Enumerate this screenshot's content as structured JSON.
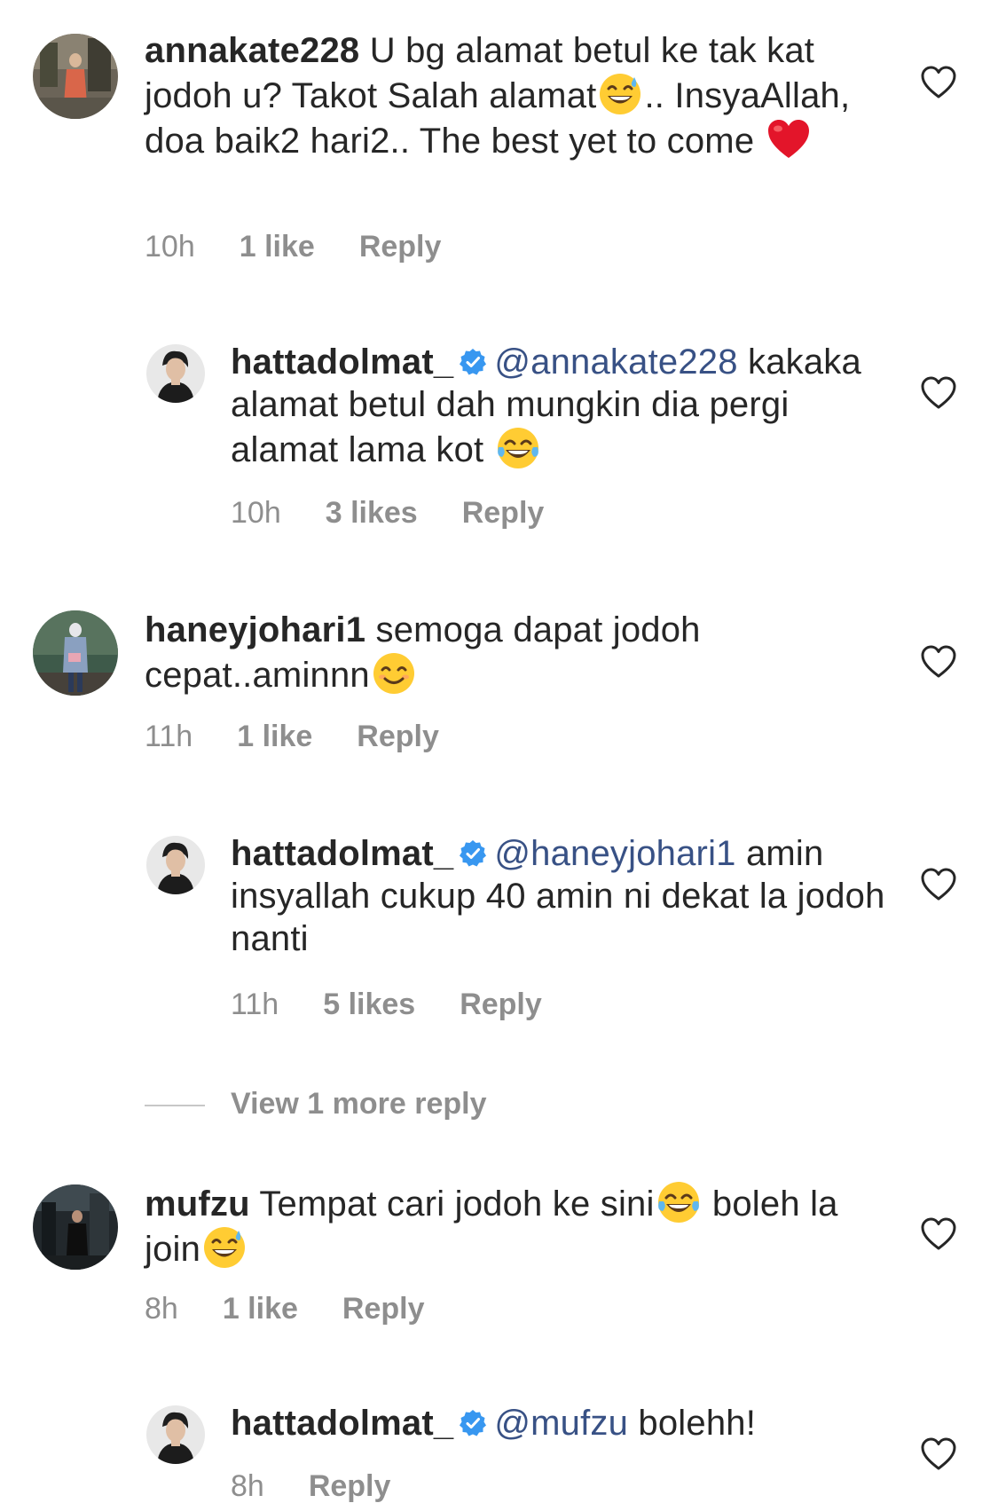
{
  "comments": [
    {
      "username": "annakate228",
      "text_1": "U bg alamat betul ke tak kat jodoh u? Takot Salah alamat",
      "emoji_1": "sweat-smile-emoji",
      "text_2": ".. InsyaAllah, doa baik2 hari2.. The best yet to come",
      "emoji_2": "red-heart-emoji",
      "time": "10h",
      "likes": "1 like",
      "reply": "Reply"
    },
    {
      "username": "hattadolmat_",
      "verified": true,
      "mention": "@annakate228",
      "text_1": "kakaka alamat betul dah mungkin dia pergi alamat lama kot",
      "emoji_1": "tears-of-joy-emoji",
      "time": "10h",
      "likes": "3 likes",
      "reply": "Reply"
    },
    {
      "username": "haneyjohari1",
      "text_1": "semoga dapat jodoh cepat..aminnn",
      "emoji_1": "smiling-emoji",
      "time": "11h",
      "likes": "1 like",
      "reply": "Reply"
    },
    {
      "username": "hattadolmat_",
      "verified": true,
      "mention": "@haneyjohari1",
      "text_1": "amin insyallah cukup 40 amin ni dekat la jodoh nanti",
      "time": "11h",
      "likes": "5 likes",
      "reply": "Reply"
    },
    {
      "username": "mufzu",
      "text_1": "Tempat cari jodoh ke sini",
      "emoji_1": "tears-of-joy-emoji",
      "text_2": " boleh la join",
      "emoji_2": "sweat-smile-emoji",
      "time": "8h",
      "likes": "1 like",
      "reply": "Reply"
    },
    {
      "username": "hattadolmat_",
      "verified": true,
      "mention": "@mufzu",
      "text_1": "bolehh!",
      "time": "8h",
      "reply": "Reply"
    }
  ],
  "view_more": "View 1 more reply",
  "colors": {
    "text": "#262626",
    "meta": "#8e8e8e",
    "mention": "#385185",
    "verified": "#3897f0"
  }
}
